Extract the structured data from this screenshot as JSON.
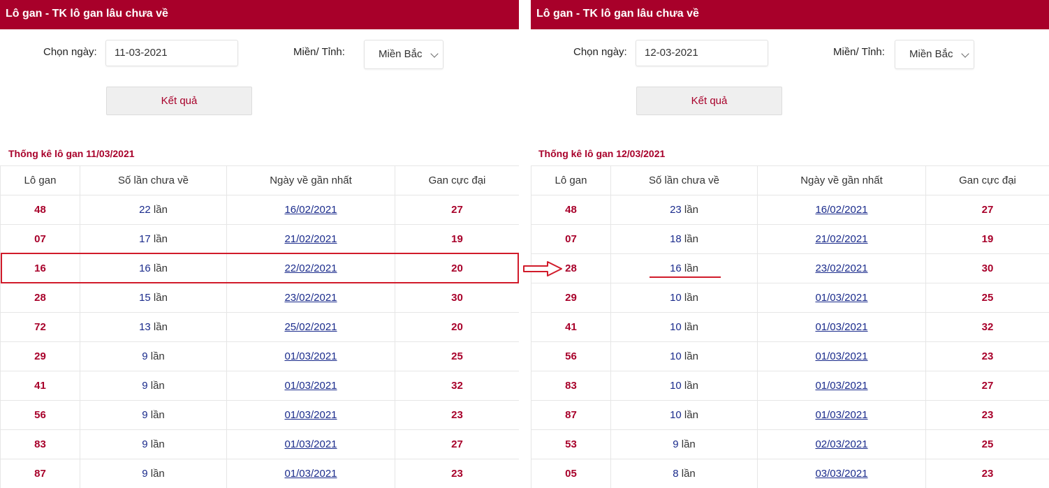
{
  "left": {
    "header": "Lô gan - TK lô gan lâu chưa về",
    "date_label": "Chọn ngày:",
    "date_value": "11-03-2021",
    "region_label": "Miền/ Tỉnh:",
    "region_value": "Miền Bắc",
    "button_label": "Kết quả",
    "section_title": "Thống kê lô gan 11/03/2021",
    "columns": [
      "Lô gan",
      "Số lần chưa về",
      "Ngày về gần nhất",
      "Gan cực đại"
    ],
    "rows": [
      {
        "num": "48",
        "count": "22",
        "unit": " lần",
        "date": "16/02/2021",
        "max": "27"
      },
      {
        "num": "07",
        "count": "17",
        "unit": " lần",
        "date": "21/02/2021",
        "max": "19"
      },
      {
        "num": "16",
        "count": "16",
        "unit": " lần",
        "date": "22/02/2021",
        "max": "20"
      },
      {
        "num": "28",
        "count": "15",
        "unit": " lần",
        "date": "23/02/2021",
        "max": "30"
      },
      {
        "num": "72",
        "count": "13",
        "unit": " lần",
        "date": "25/02/2021",
        "max": "20"
      },
      {
        "num": "29",
        "count": "9",
        "unit": " lần",
        "date": "01/03/2021",
        "max": "25"
      },
      {
        "num": "41",
        "count": "9",
        "unit": " lần",
        "date": "01/03/2021",
        "max": "32"
      },
      {
        "num": "56",
        "count": "9",
        "unit": " lần",
        "date": "01/03/2021",
        "max": "23"
      },
      {
        "num": "83",
        "count": "9",
        "unit": " lần",
        "date": "01/03/2021",
        "max": "27"
      },
      {
        "num": "87",
        "count": "9",
        "unit": " lần",
        "date": "01/03/2021",
        "max": "23"
      }
    ]
  },
  "right": {
    "header": "Lô gan - TK lô gan lâu chưa về",
    "date_label": "Chọn ngày:",
    "date_value": "12-03-2021",
    "region_label": "Miền/ Tỉnh:",
    "region_value": "Miền Bắc",
    "button_label": "Kết quả",
    "section_title": "Thống kê lô gan 12/03/2021",
    "columns": [
      "Lô gan",
      "Số lần chưa về",
      "Ngày về gần nhất",
      "Gan cực đại"
    ],
    "rows": [
      {
        "num": "48",
        "count": "23",
        "unit": " lần",
        "date": "16/02/2021",
        "max": "27"
      },
      {
        "num": "07",
        "count": "18",
        "unit": " lần",
        "date": "21/02/2021",
        "max": "19"
      },
      {
        "num": "28",
        "count": "16",
        "unit": " lần",
        "date": "23/02/2021",
        "max": "30"
      },
      {
        "num": "29",
        "count": "10",
        "unit": " lần",
        "date": "01/03/2021",
        "max": "25"
      },
      {
        "num": "41",
        "count": "10",
        "unit": " lần",
        "date": "01/03/2021",
        "max": "32"
      },
      {
        "num": "56",
        "count": "10",
        "unit": " lần",
        "date": "01/03/2021",
        "max": "23"
      },
      {
        "num": "83",
        "count": "10",
        "unit": " lần",
        "date": "01/03/2021",
        "max": "27"
      },
      {
        "num": "87",
        "count": "10",
        "unit": " lần",
        "date": "01/03/2021",
        "max": "23"
      },
      {
        "num": "53",
        "count": "9",
        "unit": " lần",
        "date": "02/03/2021",
        "max": "25"
      },
      {
        "num": "05",
        "count": "8",
        "unit": " lần",
        "date": "03/03/2021",
        "max": "23"
      }
    ]
  },
  "colors": {
    "brand": "#a8002a",
    "link": "#1a2b8c",
    "highlight": "#d11b2a"
  },
  "annotations": {
    "left_highlighted_row": "16",
    "arrow_icon": "right-arrow-icon",
    "right_underlined_cell": "16 lần"
  }
}
